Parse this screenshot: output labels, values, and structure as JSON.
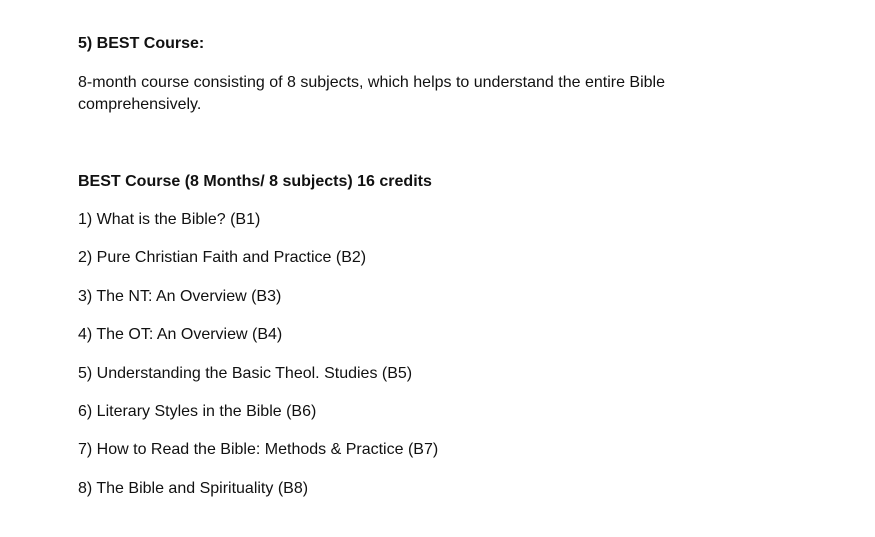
{
  "section": {
    "heading": "5) BEST Course:",
    "description": "8-month course consisting of 8 subjects, which helps to understand the entire Bible comprehensively."
  },
  "course": {
    "title": "BEST Course (8 Months/ 8 subjects) 16 credits",
    "subjects": [
      "1) What is the Bible? (B1)",
      "2) Pure Christian Faith and Practice (B2)",
      "3) The NT: An Overview (B3)",
      "4) The OT: An Overview (B4)",
      "5) Understanding the Basic Theol. Studies (B5)",
      "6) Literary Styles in the Bible (B6)",
      "7) How to Read the Bible: Methods & Practice (B7)",
      "8) The Bible and Spirituality (B8)"
    ]
  }
}
